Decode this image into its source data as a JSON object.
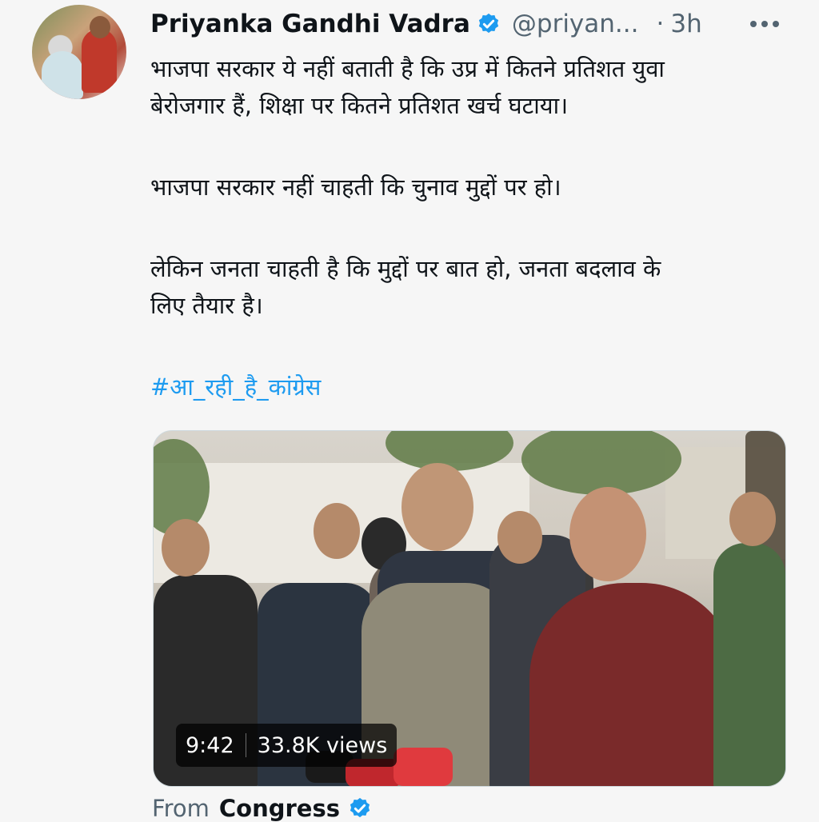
{
  "author": {
    "name": "Priyanka Gandhi Vadra",
    "handle": "@priyan...",
    "separator": "·",
    "time": "3h"
  },
  "tweet": {
    "lines": [
      "भाजपा सरकार ये नहीं बताती है कि उप्र में कितने प्रतिशत युवा",
      "बेरोजगार हैं, शिक्षा पर कितने प्रतिशत खर्च घटाया।",
      "भाजपा सरकार नहीं चाहती कि चुनाव मुद्दों पर हो।",
      "लेकिन जनता चाहती है कि मुद्दों पर बात हो, जनता बदलाव के",
      "लिए तैयार है।"
    ],
    "hashtag": "#आ_रही_है_कांग्रेस"
  },
  "video": {
    "duration": "9:42",
    "views": "33.8K views"
  },
  "source": {
    "prefix": "From",
    "name": "Congress"
  },
  "colors": {
    "link": "#1d9bf0",
    "verified": "#1d9bf0",
    "secondary_text": "#536471"
  },
  "icons": {
    "verified": "verified-badge-icon",
    "more": "more-options-icon"
  }
}
